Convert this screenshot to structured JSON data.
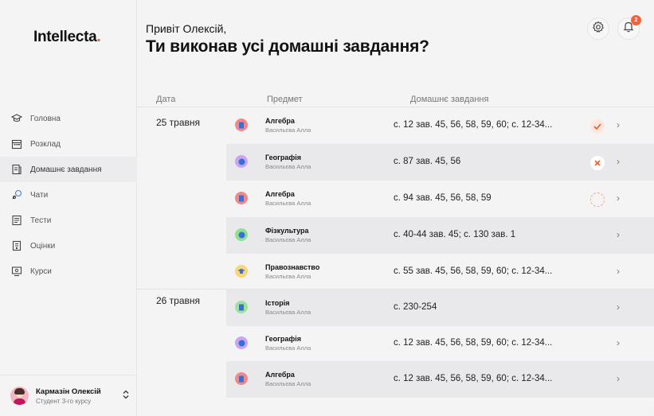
{
  "app": {
    "logo_text": "Intellecta",
    "logo_dot": "."
  },
  "sidebar": {
    "items": [
      {
        "label": "Головна",
        "icon": "graduation-cap-icon"
      },
      {
        "label": "Розклад",
        "icon": "calendar-icon"
      },
      {
        "label": "Домашнє завдання",
        "icon": "homework-icon",
        "active": true
      },
      {
        "label": "Чати",
        "icon": "chat-icon"
      },
      {
        "label": "Тести",
        "icon": "tests-icon"
      },
      {
        "label": "Оцінки",
        "icon": "grades-icon"
      },
      {
        "label": "Курси",
        "icon": "courses-icon"
      }
    ],
    "user": {
      "name": "Кармазін Олексій",
      "role": "Студент 3-го курсу"
    }
  },
  "header": {
    "greeting": "Привіт Олексій,",
    "headline": "Ти виконав усі домашні завдання?",
    "notifications_count": "2"
  },
  "table": {
    "columns": {
      "date": "Дата",
      "subject": "Предмет",
      "homework": "Домашнє завдання"
    },
    "groups": [
      {
        "date": "25 травня",
        "rows": [
          {
            "subject": "Алгебра",
            "teacher": "Васильєва Алла",
            "homework": "с. 12 зав. 45, 56, 58, 59, 60; с. 12-34...",
            "status": "done",
            "icon_color": "#f08a8a"
          },
          {
            "subject": "Географія",
            "teacher": "Васильєва Алла",
            "homework": "с. 87 зав. 45, 56",
            "status": "failed",
            "icon_color": "#c9a6f2"
          },
          {
            "subject": "Алгебра",
            "teacher": "Васильєва Алла",
            "homework": "с. 94 зав. 45, 56, 58, 59",
            "status": "pending",
            "icon_color": "#f08a8a"
          },
          {
            "subject": "Фізкультура",
            "teacher": "Васильєва Алла",
            "homework": "с. 40-44 зав. 45; с. 130 зав. 1",
            "status": "none",
            "icon_color": "#8fe08f"
          },
          {
            "subject": "Правознавство",
            "teacher": "Васильєва Алла",
            "homework": "с. 55 зав. 45, 56, 58, 59, 60; с. 12-34...",
            "status": "none",
            "icon_color": "#f7d77a"
          }
        ]
      },
      {
        "date": "26 травня",
        "rows": [
          {
            "subject": "Історія",
            "teacher": "Васильєва Алла",
            "homework": "с. 230-254",
            "status": "none",
            "icon_color": "#9fe39a"
          },
          {
            "subject": "Географія",
            "teacher": "Васильєва Алла",
            "homework": "с. 12 зав. 45, 56, 58, 59, 60; с. 12-34...",
            "status": "none",
            "icon_color": "#c9a6f2"
          },
          {
            "subject": "Алгебра",
            "teacher": "Васильєва Алла",
            "homework": "с. 12 зав. 45, 56, 58, 59, 60; с. 12-34...",
            "status": "none",
            "icon_color": "#f08a8a"
          }
        ]
      }
    ]
  }
}
